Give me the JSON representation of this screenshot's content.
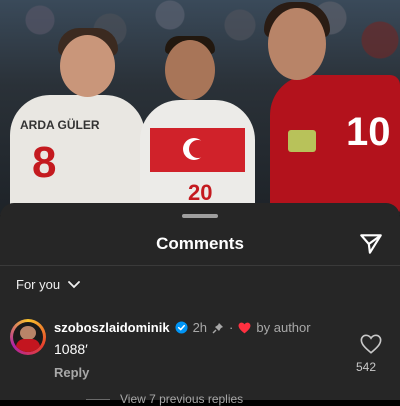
{
  "sheet": {
    "title": "Comments",
    "filter_label": "For you"
  },
  "comment": {
    "username": "szoboszlaidominik",
    "time": "2h",
    "separator": "·",
    "liked_by": "by author",
    "text": "1088′",
    "reply_label": "Reply",
    "like_count": "542",
    "view_replies": "View 7 previous replies"
  },
  "photo": {
    "jersey_name": "ARDA GÜLER",
    "number_left": "8",
    "number_center": "20",
    "number_right": "10"
  },
  "colors": {
    "sheet_bg": "#262626",
    "heart_red": "#ff3040",
    "verified_blue": "#0095f6",
    "secondary_text": "#a8a8a8"
  },
  "icons": {
    "share": "paper-plane-icon",
    "chevron": "chevron-down-icon",
    "verified": "verified-badge-icon",
    "pin": "pin-icon",
    "heart_filled": "heart-filled-icon",
    "like": "heart-outline-icon"
  }
}
